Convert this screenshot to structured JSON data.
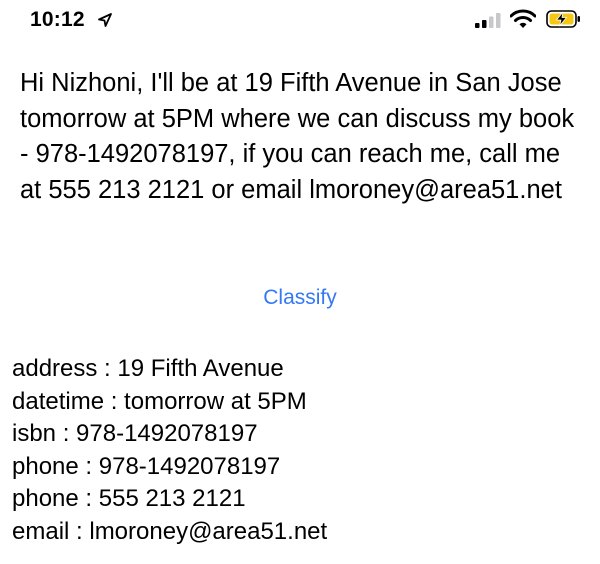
{
  "status_bar": {
    "time": "10:12",
    "icons": [
      "location-arrow-icon",
      "cellular-signal-icon",
      "wifi-icon",
      "battery-charging-icon"
    ],
    "battery_color": "#f5c816"
  },
  "main": {
    "message": "Hi Nizhoni, I'll be at 19 Fifth Avenue in San Jose tomorrow at 5PM where we can discuss my book - 978-1492078197, if you can reach me, call me at 555 213 2121 or email lmoroney@area51.net",
    "classify_label": "Classify",
    "accent_color": "#3478f6",
    "results": [
      "address : 19 Fifth Avenue",
      "datetime : tomorrow at 5PM",
      "isbn : 978-1492078197",
      "phone : 978-1492078197",
      "phone : 555 213 2121",
      "email : lmoroney@area51.net"
    ]
  }
}
